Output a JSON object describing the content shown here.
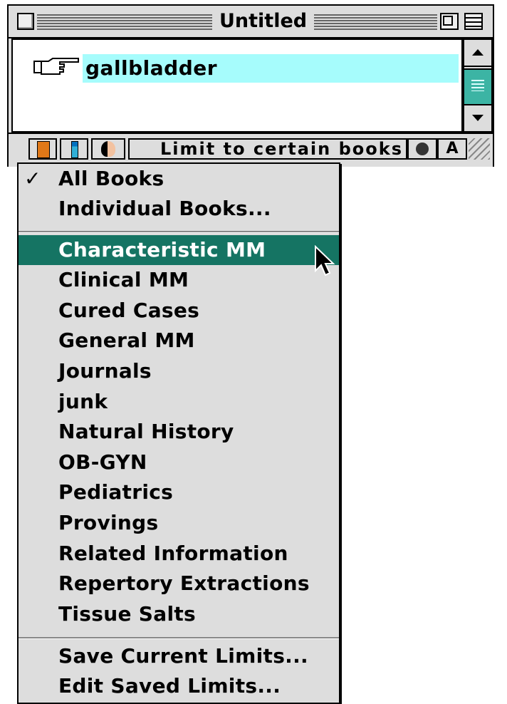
{
  "window": {
    "title": "Untitled",
    "query": "gallbladder",
    "highlight_color": "#a6fcfc"
  },
  "toolbar": {
    "limit_label": "Limit to certain books",
    "font_button": "A"
  },
  "menu": {
    "selected_color": "#157463",
    "check_mark": "✓",
    "top_items": [
      {
        "label": "All Books",
        "checked": true
      },
      {
        "label": "Individual Books..."
      }
    ],
    "book_items": [
      {
        "label": "Characteristic MM",
        "selected": true
      },
      {
        "label": "Clinical MM"
      },
      {
        "label": "Cured Cases"
      },
      {
        "label": "General MM"
      },
      {
        "label": "Journals"
      },
      {
        "label": "junk"
      },
      {
        "label": "Natural History"
      },
      {
        "label": "OB-GYN"
      },
      {
        "label": "Pediatrics"
      },
      {
        "label": "Provings"
      },
      {
        "label": "Related Information"
      },
      {
        "label": "Repertory Extractions"
      },
      {
        "label": "Tissue Salts"
      }
    ],
    "bottom_items": [
      {
        "label": "Save Current Limits..."
      },
      {
        "label": "Edit Saved Limits..."
      }
    ]
  }
}
